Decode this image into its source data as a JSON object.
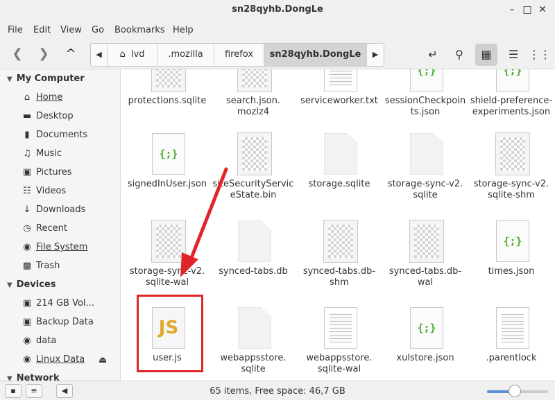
{
  "window": {
    "title": "sn28qyhb.DongLe",
    "min_icon": "minimize-icon",
    "max_icon": "maximize-icon",
    "close_icon": "close-icon"
  },
  "menu": [
    "File",
    "Edit",
    "View",
    "Go",
    "Bookmarks",
    "Help"
  ],
  "toolbar": {
    "breadcrumbs": [
      "lvd",
      ".mozilla",
      "firefox",
      "sn28qyhb.DongLe"
    ],
    "active_crumb": "sn28qyhb.DongLe"
  },
  "sidebar": {
    "sections": [
      {
        "title": "My Computer",
        "items": [
          {
            "label": "Home",
            "icon": "home-icon",
            "underline": true
          },
          {
            "label": "Desktop",
            "icon": "desktop-icon"
          },
          {
            "label": "Documents",
            "icon": "documents-icon"
          },
          {
            "label": "Music",
            "icon": "music-icon"
          },
          {
            "label": "Pictures",
            "icon": "pictures-icon"
          },
          {
            "label": "Videos",
            "icon": "videos-icon"
          },
          {
            "label": "Downloads",
            "icon": "downloads-icon"
          },
          {
            "label": "Recent",
            "icon": "recent-icon"
          },
          {
            "label": "File System",
            "icon": "filesystem-icon",
            "underline": true
          },
          {
            "label": "Trash",
            "icon": "trash-icon"
          }
        ]
      },
      {
        "title": "Devices",
        "items": [
          {
            "label": "214 GB Vol...",
            "icon": "drive-icon"
          },
          {
            "label": "Backup Data",
            "icon": "drive-icon"
          },
          {
            "label": "data",
            "icon": "drive-icon"
          },
          {
            "label": "Linux Data",
            "icon": "drive-icon",
            "underline": true
          }
        ]
      },
      {
        "title": "Network",
        "items": []
      }
    ]
  },
  "files": [
    {
      "name": "protections.sqlite",
      "icon": "checker-file-icon"
    },
    {
      "name": "search.json.\nmozlz4",
      "icon": "checker-file-icon"
    },
    {
      "name": "serviceworker.txt",
      "icon": "text-file-icon"
    },
    {
      "name": "sessionCheckpoin\nts.json",
      "icon": "json-file-icon"
    },
    {
      "name": "shield-preference-\nexperiments.json",
      "icon": "json-file-icon"
    },
    {
      "name": "signedInUser.json",
      "icon": "json-file-icon"
    },
    {
      "name": "siteSecurityServic\neState.bin",
      "icon": "checker-file-icon"
    },
    {
      "name": "storage.sqlite",
      "icon": "blank-file-icon"
    },
    {
      "name": "storage-sync-v2.\nsqlite",
      "icon": "blank-file-icon"
    },
    {
      "name": "storage-sync-v2.\nsqlite-shm",
      "icon": "checker-file-icon"
    },
    {
      "name": "storage-sync-v2.\nsqlite-wal",
      "icon": "checker-file-icon"
    },
    {
      "name": "synced-tabs.db",
      "icon": "blank-file-icon"
    },
    {
      "name": "synced-tabs.db-\nshm",
      "icon": "checker-file-icon"
    },
    {
      "name": "synced-tabs.db-\nwal",
      "icon": "checker-file-icon"
    },
    {
      "name": "times.json",
      "icon": "json-file-icon"
    },
    {
      "name": "user.js",
      "icon": "js-file-icon"
    },
    {
      "name": "webappsstore.\nsqlite",
      "icon": "blank-file-icon"
    },
    {
      "name": "webappsstore.\nsqlite-wal",
      "icon": "text-file-icon"
    },
    {
      "name": "xulstore.json",
      "icon": "json-file-icon"
    },
    {
      "name": ".parentlock",
      "icon": "text-file-icon"
    }
  ],
  "icon_glyphs": {
    "json": "{;}",
    "js": "JS"
  },
  "status": {
    "text": "65 items, Free space: 46,7 GB",
    "zoom_level": 0.45
  },
  "colors": {
    "annotation_red": "#e0242a",
    "json_green": "#4caf30",
    "js_yellow": "#e0a82e"
  }
}
